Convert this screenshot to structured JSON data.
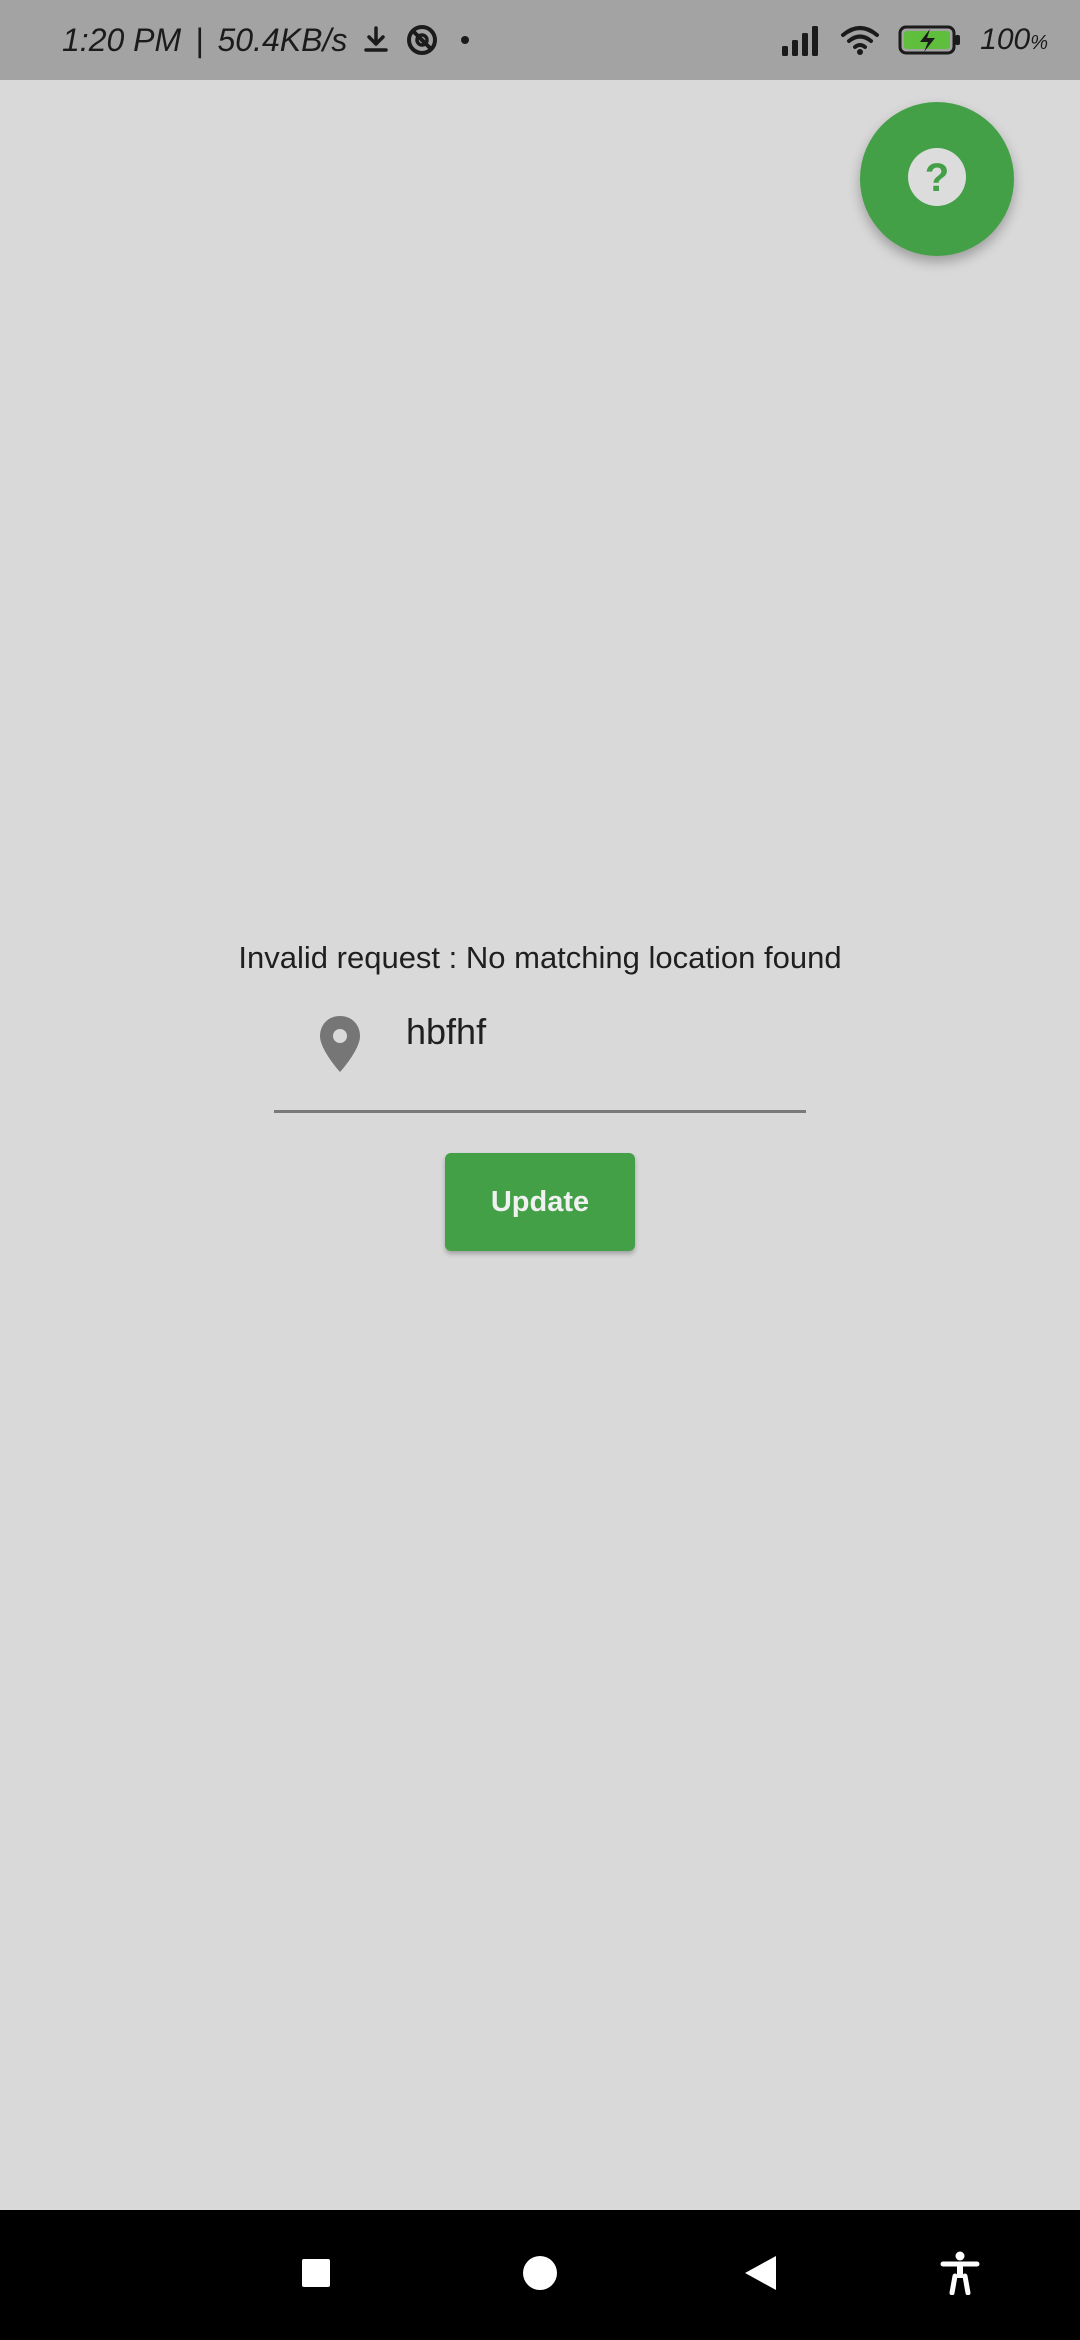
{
  "status_bar": {
    "time": "1:20 PM",
    "separator": "|",
    "network_speed": "50.4KB/s",
    "battery_percent": "100",
    "battery_unit": "%",
    "icons": [
      "download-icon",
      "vpn-icon",
      "dot-icon",
      "signal-icon",
      "wifi-icon",
      "battery-charging-icon"
    ]
  },
  "fab": {
    "icon": "help-icon",
    "label": "?"
  },
  "main": {
    "error_message": "Invalid request : No matching location found",
    "location_input": {
      "value": "hbfhf",
      "icon": "location-pin-icon"
    },
    "update_button": "Update"
  },
  "nav_bar": {
    "buttons": [
      "recents-button",
      "home-button",
      "back-button",
      "accessibility-button"
    ]
  },
  "colors": {
    "accent": "#43a047",
    "background": "#d9d9d9",
    "status_bar": "#a3a3a3",
    "nav_bar": "#000000"
  }
}
